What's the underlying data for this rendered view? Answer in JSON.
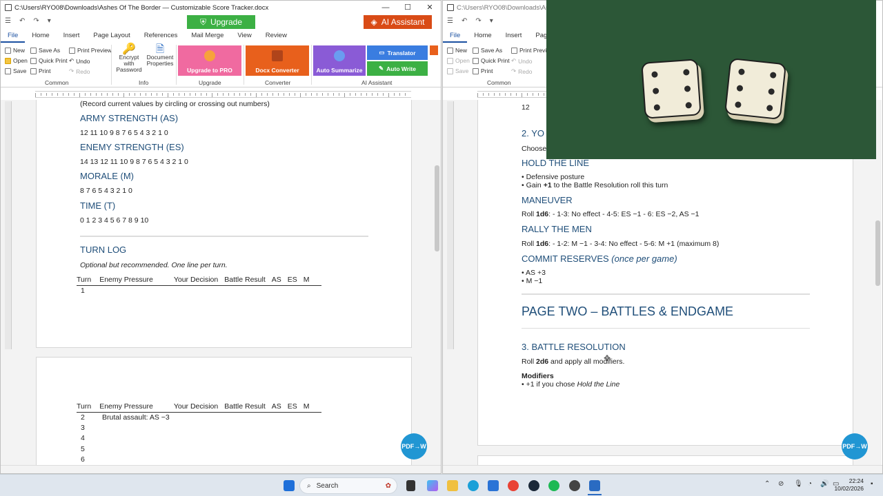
{
  "left_window": {
    "title": "C:\\Users\\RYO08\\Downloads\\Ashes Of The Border — Customizable Score Tracker.docx",
    "upgrade_label": "Upgrade",
    "ai_label": "AI Assistant",
    "tabs": [
      "File",
      "Home",
      "Insert",
      "Page Layout",
      "References",
      "Mail Merge",
      "View",
      "Review"
    ],
    "ribbon": {
      "new": "New",
      "save_as": "Save As",
      "print_preview": "Print Preview",
      "open": "Open",
      "quick_print": "Quick Print",
      "undo": "Undo",
      "save": "Save",
      "print": "Print",
      "redo": "Redo",
      "encrypt": "Encrypt with Password",
      "doc_props": "Document Properties",
      "upgrade_pro": "Upgrade to PRO",
      "docx_converter": "Docx Converter",
      "auto_summarize": "Auto Summarize",
      "translator": "Translator",
      "auto_write": "Auto Write",
      "groups": [
        "Common",
        "Info",
        "Upgrade",
        "Converter",
        "AI Assistant"
      ]
    },
    "doc": {
      "record_note": "(Record current values by circling or crossing out numbers)",
      "army_h": "ARMY STRENGTH (AS)",
      "army_v": "12 11 10 9 8 7 6 5 4 3 2 1 0",
      "enemy_h": "ENEMY STRENGTH (ES)",
      "enemy_v": "14 13 12 11 10 9 8 7 6 5 4 3 2 1 0",
      "morale_h": "MORALE (M)",
      "morale_v": "8 7 6 5 4 3 2 1 0",
      "time_h": "TIME (T)",
      "time_v": "0 1 2 3 4 5 6 7 8 9 10",
      "turnlog_h": "TURN LOG",
      "turnlog_note": "Optional but recommended.  One line per turn.",
      "table_cols": [
        "Turn",
        "Enemy Pressure",
        "Your Decision",
        "Battle Result",
        "AS",
        "ES",
        "M"
      ],
      "row1": "1",
      "rows2": [
        {
          "turn": "2",
          "pressure": "Brutal assault: AS −3"
        },
        {
          "turn": "3",
          "pressure": ""
        },
        {
          "turn": "4",
          "pressure": ""
        },
        {
          "turn": "5",
          "pressure": ""
        },
        {
          "turn": "6",
          "pressure": ""
        }
      ]
    }
  },
  "right_window": {
    "title": "C:\\Users\\RYO08\\Downloads\\Ashes O",
    "tabs": [
      "File",
      "Home",
      "Insert",
      "Page L"
    ],
    "ribbon": {
      "new": "New",
      "save_as": "Save As",
      "print_preview": "Print Preview",
      "open": "Open",
      "quick_print": "Quick Print",
      "undo": "Undo",
      "save": "Save",
      "print": "Print",
      "redo": "Redo",
      "group": "Common"
    },
    "doc": {
      "top_num": "12",
      "sec2_h": "2. YO",
      "choose": "Choose",
      "hold_h": "HOLD THE LINE",
      "hold_1": "• Defensive posture",
      "hold_2a": "• Gain ",
      "hold_2b": "+1",
      "hold_2c": " to the Battle Resolution roll this turn",
      "man_h": "MANEUVER",
      "man_a": "Roll ",
      "man_b": "1d6",
      "man_c": ": - 1-3: No effect - 4-5: ES −1 - 6: ES −2, AS −1",
      "rally_h": "RALLY THE MEN",
      "rally_a": "Roll ",
      "rally_b": "1d6",
      "rally_c": ": - 1-2: M −1 - 3-4: No effect - 5-6: M +1 (maximum 8)",
      "commit_h": "COMMIT RESERVES",
      "commit_i": "(once per game)",
      "commit_1": "• AS +3",
      "commit_2": "• M −1",
      "page2_h": "PAGE TWO – BATTLES & ENDGAME",
      "sec3_h": "3. BATTLE RESOLUTION",
      "roll_a": "Roll ",
      "roll_b": "2d6",
      "roll_c": " and apply all modifiers.",
      "mod_h": "Modifiers",
      "mod_1a": "• +1 if you chose ",
      "mod_1b": "Hold the Line"
    }
  },
  "pdf_badge": "PDF→W",
  "taskbar": {
    "search": "Search",
    "time": "22:24",
    "date": "10/02/2026"
  },
  "colors": {
    "heading": "#1f4e79",
    "green": "#3cb044",
    "orange": "#d94b16",
    "table_green": "#2c5737"
  }
}
